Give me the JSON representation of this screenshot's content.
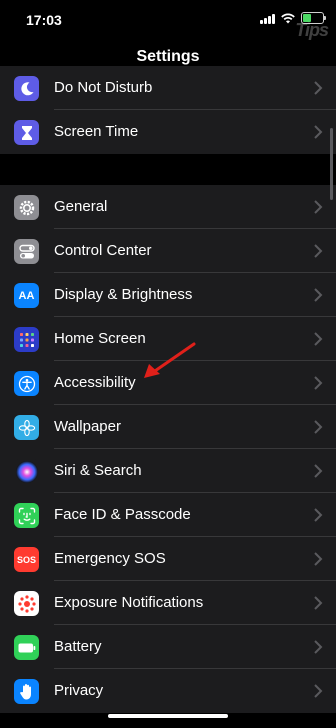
{
  "status_bar": {
    "time": "17:03"
  },
  "watermark": "Tips",
  "nav": {
    "title": "Settings"
  },
  "group_top": [
    {
      "label": "Do Not Disturb",
      "icon": "moon-icon",
      "color": "#5e5ce6"
    },
    {
      "label": "Screen Time",
      "icon": "hourglass-icon",
      "color": "#5e5ce6"
    }
  ],
  "group_main": [
    {
      "label": "General",
      "icon": "gear-icon",
      "color": "#8e8e93"
    },
    {
      "label": "Control Center",
      "icon": "toggles-icon",
      "color": "#8e8e93"
    },
    {
      "label": "Display & Brightness",
      "icon": "display-aa-icon",
      "icon_text": "AA",
      "color": "#0a84ff"
    },
    {
      "label": "Home Screen",
      "icon": "home-grid-icon",
      "color": "#2c3cc8"
    },
    {
      "label": "Accessibility",
      "icon": "accessibility-icon",
      "color": "#0a84ff"
    },
    {
      "label": "Wallpaper",
      "icon": "flower-icon",
      "color": "#32ade6"
    },
    {
      "label": "Siri & Search",
      "icon": "siri-icon",
      "color": "#1c1c1e"
    },
    {
      "label": "Face ID & Passcode",
      "icon": "face-id-icon",
      "color": "#30d158"
    },
    {
      "label": "Emergency SOS",
      "icon": "sos-icon",
      "icon_text": "SOS",
      "color": "#ff3b30"
    },
    {
      "label": "Exposure Notifications",
      "icon": "exposure-icon",
      "color": "#ffffff"
    },
    {
      "label": "Battery",
      "icon": "battery-icon",
      "color": "#30d158"
    },
    {
      "label": "Privacy",
      "icon": "hand-icon",
      "color": "#0a84ff"
    }
  ]
}
